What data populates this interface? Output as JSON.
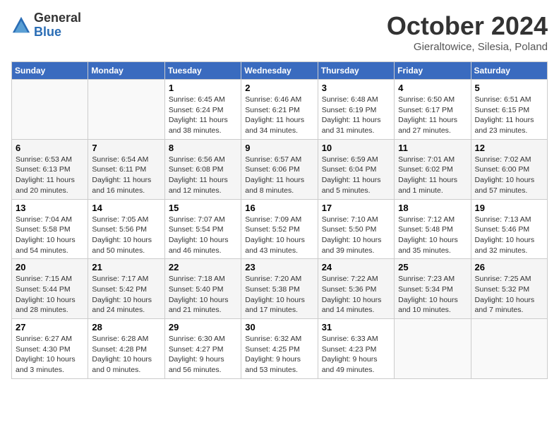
{
  "logo": {
    "general": "General",
    "blue": "Blue"
  },
  "title": "October 2024",
  "subtitle": "Gieraltowice, Silesia, Poland",
  "headers": [
    "Sunday",
    "Monday",
    "Tuesday",
    "Wednesday",
    "Thursday",
    "Friday",
    "Saturday"
  ],
  "weeks": [
    [
      {
        "day": "",
        "info": ""
      },
      {
        "day": "",
        "info": ""
      },
      {
        "day": "1",
        "info": "Sunrise: 6:45 AM\nSunset: 6:24 PM\nDaylight: 11 hours and 38 minutes."
      },
      {
        "day": "2",
        "info": "Sunrise: 6:46 AM\nSunset: 6:21 PM\nDaylight: 11 hours and 34 minutes."
      },
      {
        "day": "3",
        "info": "Sunrise: 6:48 AM\nSunset: 6:19 PM\nDaylight: 11 hours and 31 minutes."
      },
      {
        "day": "4",
        "info": "Sunrise: 6:50 AM\nSunset: 6:17 PM\nDaylight: 11 hours and 27 minutes."
      },
      {
        "day": "5",
        "info": "Sunrise: 6:51 AM\nSunset: 6:15 PM\nDaylight: 11 hours and 23 minutes."
      }
    ],
    [
      {
        "day": "6",
        "info": "Sunrise: 6:53 AM\nSunset: 6:13 PM\nDaylight: 11 hours and 20 minutes."
      },
      {
        "day": "7",
        "info": "Sunrise: 6:54 AM\nSunset: 6:11 PM\nDaylight: 11 hours and 16 minutes."
      },
      {
        "day": "8",
        "info": "Sunrise: 6:56 AM\nSunset: 6:08 PM\nDaylight: 11 hours and 12 minutes."
      },
      {
        "day": "9",
        "info": "Sunrise: 6:57 AM\nSunset: 6:06 PM\nDaylight: 11 hours and 8 minutes."
      },
      {
        "day": "10",
        "info": "Sunrise: 6:59 AM\nSunset: 6:04 PM\nDaylight: 11 hours and 5 minutes."
      },
      {
        "day": "11",
        "info": "Sunrise: 7:01 AM\nSunset: 6:02 PM\nDaylight: 11 hours and 1 minute."
      },
      {
        "day": "12",
        "info": "Sunrise: 7:02 AM\nSunset: 6:00 PM\nDaylight: 10 hours and 57 minutes."
      }
    ],
    [
      {
        "day": "13",
        "info": "Sunrise: 7:04 AM\nSunset: 5:58 PM\nDaylight: 10 hours and 54 minutes."
      },
      {
        "day": "14",
        "info": "Sunrise: 7:05 AM\nSunset: 5:56 PM\nDaylight: 10 hours and 50 minutes."
      },
      {
        "day": "15",
        "info": "Sunrise: 7:07 AM\nSunset: 5:54 PM\nDaylight: 10 hours and 46 minutes."
      },
      {
        "day": "16",
        "info": "Sunrise: 7:09 AM\nSunset: 5:52 PM\nDaylight: 10 hours and 43 minutes."
      },
      {
        "day": "17",
        "info": "Sunrise: 7:10 AM\nSunset: 5:50 PM\nDaylight: 10 hours and 39 minutes."
      },
      {
        "day": "18",
        "info": "Sunrise: 7:12 AM\nSunset: 5:48 PM\nDaylight: 10 hours and 35 minutes."
      },
      {
        "day": "19",
        "info": "Sunrise: 7:13 AM\nSunset: 5:46 PM\nDaylight: 10 hours and 32 minutes."
      }
    ],
    [
      {
        "day": "20",
        "info": "Sunrise: 7:15 AM\nSunset: 5:44 PM\nDaylight: 10 hours and 28 minutes."
      },
      {
        "day": "21",
        "info": "Sunrise: 7:17 AM\nSunset: 5:42 PM\nDaylight: 10 hours and 24 minutes."
      },
      {
        "day": "22",
        "info": "Sunrise: 7:18 AM\nSunset: 5:40 PM\nDaylight: 10 hours and 21 minutes."
      },
      {
        "day": "23",
        "info": "Sunrise: 7:20 AM\nSunset: 5:38 PM\nDaylight: 10 hours and 17 minutes."
      },
      {
        "day": "24",
        "info": "Sunrise: 7:22 AM\nSunset: 5:36 PM\nDaylight: 10 hours and 14 minutes."
      },
      {
        "day": "25",
        "info": "Sunrise: 7:23 AM\nSunset: 5:34 PM\nDaylight: 10 hours and 10 minutes."
      },
      {
        "day": "26",
        "info": "Sunrise: 7:25 AM\nSunset: 5:32 PM\nDaylight: 10 hours and 7 minutes."
      }
    ],
    [
      {
        "day": "27",
        "info": "Sunrise: 6:27 AM\nSunset: 4:30 PM\nDaylight: 10 hours and 3 minutes."
      },
      {
        "day": "28",
        "info": "Sunrise: 6:28 AM\nSunset: 4:28 PM\nDaylight: 10 hours and 0 minutes."
      },
      {
        "day": "29",
        "info": "Sunrise: 6:30 AM\nSunset: 4:27 PM\nDaylight: 9 hours and 56 minutes."
      },
      {
        "day": "30",
        "info": "Sunrise: 6:32 AM\nSunset: 4:25 PM\nDaylight: 9 hours and 53 minutes."
      },
      {
        "day": "31",
        "info": "Sunrise: 6:33 AM\nSunset: 4:23 PM\nDaylight: 9 hours and 49 minutes."
      },
      {
        "day": "",
        "info": ""
      },
      {
        "day": "",
        "info": ""
      }
    ]
  ]
}
